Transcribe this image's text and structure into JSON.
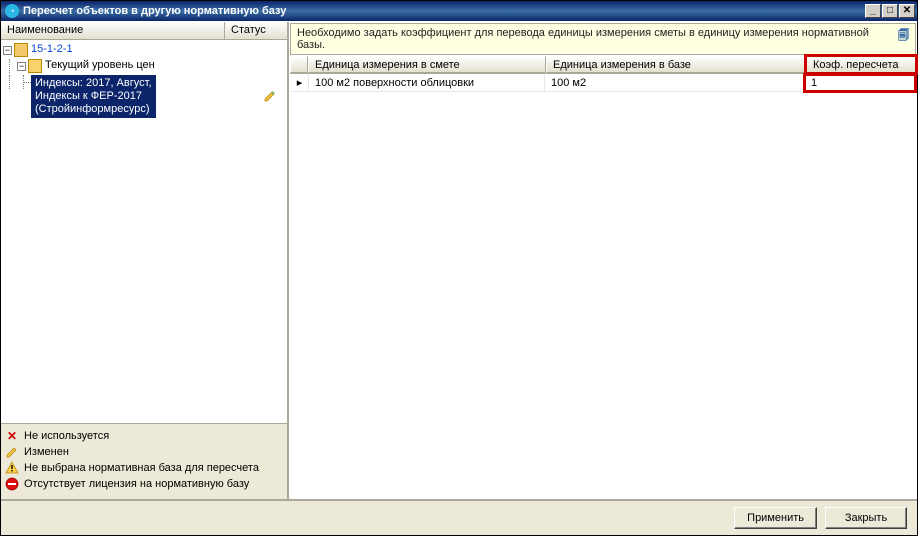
{
  "window": {
    "title": "Пересчет объектов в другую нормативную базу"
  },
  "tree": {
    "columns": {
      "name": "Наименование",
      "status": "Статус"
    },
    "root_label": "15-1-2-1",
    "child_label": "Текущий уровень цен",
    "selected_label": "Индексы: 2017, Август,\nИндексы к ФЕР-2017\n(Стройинформресурс)"
  },
  "legend": {
    "unused": "Не используется",
    "changed": "Изменен",
    "no_base": "Не выбрана нормативная база для пересчета",
    "no_license": "Отсутствует лицензия на нормативную базу"
  },
  "info_text": "Необходимо задать коэффициент для перевода единицы измерения сметы в единицу измерения нормативной базы.",
  "grid": {
    "columns": {
      "unit_estimate": "Единица измерения в смете",
      "unit_base": "Единица измерения в базе",
      "coef": "Коэф. пересчета"
    },
    "row": {
      "unit_estimate": "100 м2 поверхности облицовки",
      "unit_base": "100 м2",
      "coef": "1"
    }
  },
  "buttons": {
    "apply": "Применить",
    "close": "Закрыть"
  }
}
